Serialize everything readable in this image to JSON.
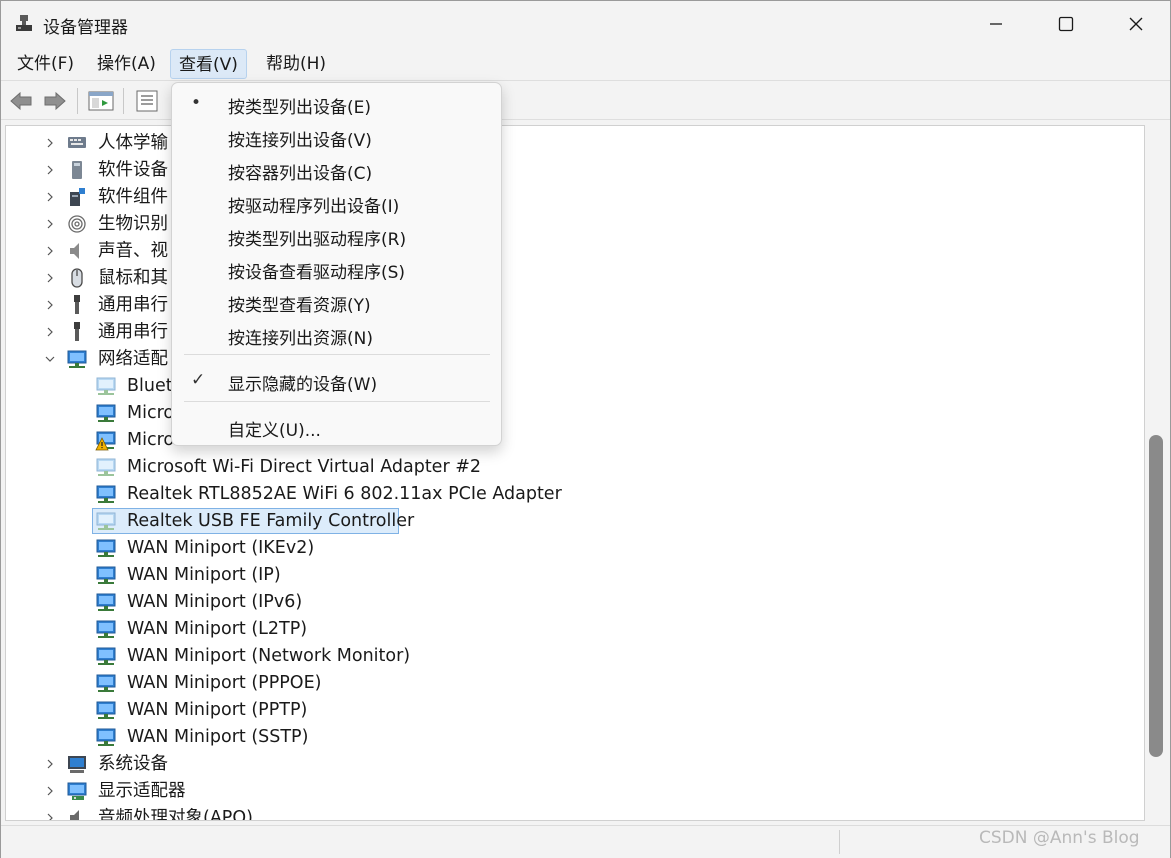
{
  "window": {
    "title": "设备管理器"
  },
  "menubar": {
    "items": [
      "文件(F)",
      "操作(A)",
      "查看(V)",
      "帮助(H)"
    ],
    "active_index": 2
  },
  "view_menu": {
    "items": [
      {
        "label": "按类型列出设备(E)",
        "mark": "•"
      },
      {
        "label": "按连接列出设备(V)",
        "mark": ""
      },
      {
        "label": "按容器列出设备(C)",
        "mark": ""
      },
      {
        "label": "按驱动程序列出设备(I)",
        "mark": ""
      },
      {
        "label": "按类型列出驱动程序(R)",
        "mark": ""
      },
      {
        "label": "按设备查看驱动程序(S)",
        "mark": ""
      },
      {
        "label": "按类型查看资源(Y)",
        "mark": ""
      },
      {
        "label": "按连接列出资源(N)",
        "mark": ""
      },
      {
        "label": "显示隐藏的设备(W)",
        "mark": "✓"
      },
      {
        "label": "自定义(U)...",
        "mark": ""
      }
    ]
  },
  "tree": {
    "categories_top": [
      {
        "label": "人体学输",
        "icon": "hid-icon"
      },
      {
        "label": "软件设备",
        "icon": "software-device-icon"
      },
      {
        "label": "软件组件",
        "icon": "software-component-icon"
      },
      {
        "label": "生物识别",
        "icon": "fingerprint-icon"
      },
      {
        "label": "声音、视",
        "icon": "speaker-icon"
      },
      {
        "label": "鼠标和其",
        "icon": "mouse-icon"
      },
      {
        "label": "通用串行",
        "icon": "usb-icon"
      },
      {
        "label": "通用串行",
        "icon": "usb-icon"
      }
    ],
    "network_category": {
      "label": "网络适配",
      "expanded": true
    },
    "network_adapters": [
      {
        "label": "Blueto",
        "icon": "network-adapter-disabled-icon"
      },
      {
        "label": "Micro",
        "icon": "network-adapter-icon"
      },
      {
        "label": "Micro",
        "icon": "network-adapter-warning-icon"
      },
      {
        "label": "Microsoft Wi-Fi Direct Virtual Adapter #2",
        "icon": "network-adapter-disabled-icon"
      },
      {
        "label": "Realtek RTL8852AE WiFi 6 802.11ax PCIe Adapter",
        "icon": "network-adapter-icon"
      },
      {
        "label": "Realtek USB FE Family Controller",
        "icon": "network-adapter-disabled-icon",
        "selected": true
      },
      {
        "label": "WAN Miniport (IKEv2)",
        "icon": "network-adapter-icon"
      },
      {
        "label": "WAN Miniport (IP)",
        "icon": "network-adapter-icon"
      },
      {
        "label": "WAN Miniport (IPv6)",
        "icon": "network-adapter-icon"
      },
      {
        "label": "WAN Miniport (L2TP)",
        "icon": "network-adapter-icon"
      },
      {
        "label": "WAN Miniport (Network Monitor)",
        "icon": "network-adapter-icon"
      },
      {
        "label": "WAN Miniport (PPPOE)",
        "icon": "network-adapter-icon"
      },
      {
        "label": "WAN Miniport (PPTP)",
        "icon": "network-adapter-icon"
      },
      {
        "label": "WAN Miniport (SSTP)",
        "icon": "network-adapter-icon"
      }
    ],
    "categories_bottom": [
      {
        "label": "系统设备",
        "icon": "system-device-icon"
      },
      {
        "label": "显示适配器",
        "icon": "display-adapter-icon"
      },
      {
        "label": "音频处理对象(APO)",
        "icon": "audio-apo-icon"
      }
    ]
  },
  "watermark": "CSDN @Ann's Blog",
  "colors": {
    "accent": "#2f7fd0",
    "selection_bg": "#dcecfb",
    "selection_border": "#7fb2e5",
    "warning": "#f2b200"
  }
}
